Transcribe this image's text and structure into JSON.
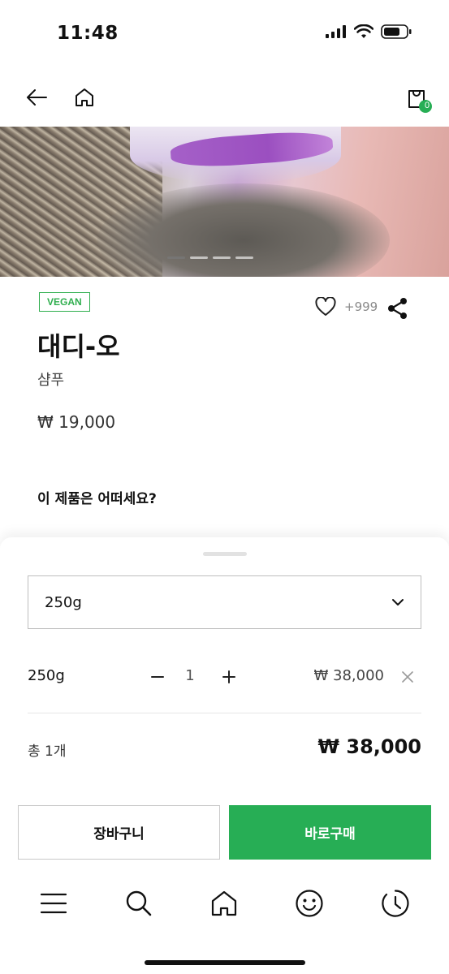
{
  "status": {
    "time": "11:48"
  },
  "nav": {
    "cart_count": "0"
  },
  "hero": {
    "pages": 4,
    "active_page": 1
  },
  "product": {
    "badge": "VEGAN",
    "wish_count": "+999",
    "name": "대디-오",
    "category": "샴푸",
    "price": "₩ 19,000",
    "question": "이 제품은 어떠세요?"
  },
  "sheet": {
    "select_value": "250g",
    "option": {
      "label": "250g",
      "quantity": "1",
      "price": "₩ 38,000"
    },
    "total_label": "총 1개",
    "total_value": "₩ 38,000",
    "cart_button": "장바구니",
    "buy_button": "바로구매"
  },
  "colors": {
    "accent": "#27ae55",
    "badge": "#2fae4e"
  },
  "tabbar": {
    "icons": [
      "menu-icon",
      "search-icon",
      "home-icon",
      "smile-icon",
      "history-icon"
    ]
  }
}
